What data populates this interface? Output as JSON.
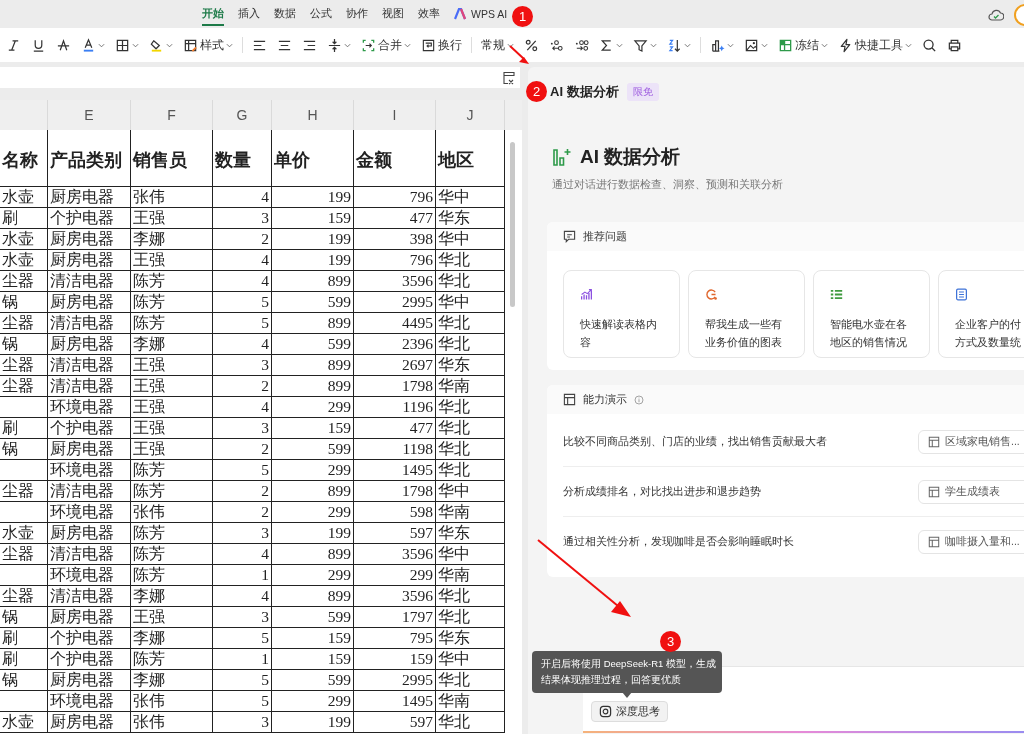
{
  "ribbon_tabs": [
    {
      "label": "开始",
      "selected": true,
      "kind": "tab"
    },
    {
      "label": "插入",
      "selected": false,
      "kind": "tab"
    },
    {
      "label": "数据",
      "selected": false,
      "kind": "tab"
    },
    {
      "label": "公式",
      "selected": false,
      "kind": "tab"
    },
    {
      "label": "协作",
      "selected": false,
      "kind": "tab"
    },
    {
      "label": "视图",
      "selected": false,
      "kind": "tab"
    },
    {
      "label": "效率",
      "selected": false,
      "kind": "tab"
    },
    {
      "label": "WPS AI",
      "selected": false,
      "kind": "ai"
    }
  ],
  "toolbar": [
    {
      "kind": "italic",
      "caret": false
    },
    {
      "kind": "underline",
      "caret": false
    },
    {
      "kind": "strike",
      "caret": false
    },
    {
      "kind": "fontcolor",
      "caret": true
    },
    {
      "kind": "border",
      "caret": true
    },
    {
      "kind": "fill",
      "caret": true
    },
    {
      "kind": "style",
      "label": "样式",
      "caret": true
    },
    {
      "kind": "separator"
    },
    {
      "kind": "alignleft",
      "caret": false
    },
    {
      "kind": "aligncenter",
      "caret": false
    },
    {
      "kind": "alignright",
      "caret": false
    },
    {
      "kind": "valign",
      "caret": true
    },
    {
      "kind": "merge",
      "label": "合并",
      "caret": true
    },
    {
      "kind": "wrap",
      "label": "换行",
      "caret": false
    },
    {
      "kind": "separator"
    },
    {
      "kind": "format",
      "label": "常规",
      "caret": true
    },
    {
      "kind": "percent",
      "caret": false
    },
    {
      "kind": "incdecimal",
      "caret": false
    },
    {
      "kind": "decdecimal",
      "caret": false
    },
    {
      "kind": "sum",
      "caret": true
    },
    {
      "kind": "filter",
      "caret": true
    },
    {
      "kind": "sort",
      "caret": true
    },
    {
      "kind": "separator"
    },
    {
      "kind": "chart",
      "caret": true
    },
    {
      "kind": "image",
      "caret": true
    },
    {
      "kind": "freeze",
      "label": "冻结",
      "caret": true
    },
    {
      "kind": "quick",
      "label": "快捷工具",
      "caret": true
    },
    {
      "kind": "search",
      "caret": false
    },
    {
      "kind": "print",
      "caret": false
    }
  ],
  "sheet": {
    "columns": [
      "E",
      "F",
      "G",
      "H",
      "I",
      "J"
    ],
    "header_row": {
      "cut": "名称",
      "cells": [
        "产品类别",
        "销售员",
        "数量",
        "单价",
        "金额",
        "地区"
      ]
    },
    "rows": [
      {
        "cut": "水壶",
        "cells": [
          "厨房电器",
          "张伟",
          "4",
          "199",
          "796",
          "华中"
        ]
      },
      {
        "cut": "刷",
        "cells": [
          "个护电器",
          "王强",
          "3",
          "159",
          "477",
          "华东"
        ]
      },
      {
        "cut": "水壶",
        "cells": [
          "厨房电器",
          "李娜",
          "2",
          "199",
          "398",
          "华中"
        ]
      },
      {
        "cut": "水壶",
        "cells": [
          "厨房电器",
          "王强",
          "4",
          "199",
          "796",
          "华北"
        ]
      },
      {
        "cut": "尘器",
        "cells": [
          "清洁电器",
          "陈芳",
          "4",
          "899",
          "3596",
          "华北"
        ]
      },
      {
        "cut": "锅",
        "cells": [
          "厨房电器",
          "陈芳",
          "5",
          "599",
          "2995",
          "华中"
        ]
      },
      {
        "cut": "尘器",
        "cells": [
          "清洁电器",
          "陈芳",
          "5",
          "899",
          "4495",
          "华北"
        ]
      },
      {
        "cut": "锅",
        "cells": [
          "厨房电器",
          "李娜",
          "4",
          "599",
          "2396",
          "华北"
        ]
      },
      {
        "cut": "尘器",
        "cells": [
          "清洁电器",
          "王强",
          "3",
          "899",
          "2697",
          "华东"
        ]
      },
      {
        "cut": "尘器",
        "cells": [
          "清洁电器",
          "王强",
          "2",
          "899",
          "1798",
          "华南"
        ]
      },
      {
        "cells": [
          "环境电器",
          "王强",
          "4",
          "299",
          "1196",
          "华北"
        ]
      },
      {
        "cut": "刷",
        "cells": [
          "个护电器",
          "王强",
          "3",
          "159",
          "477",
          "华北"
        ]
      },
      {
        "cut": "锅",
        "cells": [
          "厨房电器",
          "王强",
          "2",
          "599",
          "1198",
          "华北"
        ]
      },
      {
        "cells": [
          "环境电器",
          "陈芳",
          "5",
          "299",
          "1495",
          "华北"
        ]
      },
      {
        "cut": "尘器",
        "cells": [
          "清洁电器",
          "陈芳",
          "2",
          "899",
          "1798",
          "华中"
        ]
      },
      {
        "cells": [
          "环境电器",
          "张伟",
          "2",
          "299",
          "598",
          "华南"
        ]
      },
      {
        "cut": "水壶",
        "cells": [
          "厨房电器",
          "陈芳",
          "3",
          "199",
          "597",
          "华东"
        ]
      },
      {
        "cut": "尘器",
        "cells": [
          "清洁电器",
          "陈芳",
          "4",
          "899",
          "3596",
          "华中"
        ]
      },
      {
        "cells": [
          "环境电器",
          "陈芳",
          "1",
          "299",
          "299",
          "华南"
        ]
      },
      {
        "cut": "尘器",
        "cells": [
          "清洁电器",
          "李娜",
          "4",
          "899",
          "3596",
          "华北"
        ]
      },
      {
        "cut": "锅",
        "cells": [
          "厨房电器",
          "王强",
          "3",
          "599",
          "1797",
          "华北"
        ]
      },
      {
        "cut": "刷",
        "cells": [
          "个护电器",
          "李娜",
          "5",
          "159",
          "795",
          "华东"
        ]
      },
      {
        "cut": "刷",
        "cells": [
          "个护电器",
          "陈芳",
          "1",
          "159",
          "159",
          "华中"
        ]
      },
      {
        "cut": "锅",
        "cells": [
          "厨房电器",
          "李娜",
          "5",
          "599",
          "2995",
          "华北"
        ]
      },
      {
        "cells": [
          "环境电器",
          "张伟",
          "5",
          "299",
          "1495",
          "华南"
        ]
      },
      {
        "cut": "水壶",
        "cells": [
          "厨房电器",
          "张伟",
          "3",
          "199",
          "597",
          "华北"
        ]
      }
    ]
  },
  "panel": {
    "title": "AI 数据分析",
    "badge": "限免",
    "heading": "AI 数据分析",
    "subtitle": "通过对话进行数据检查、洞察、预测和关联分析",
    "suggestions": {
      "title": "推荐问题",
      "items": [
        {
          "lines": [
            "快速解读表格内",
            "容"
          ],
          "color": "#8b4fe0"
        },
        {
          "lines": [
            "帮我生成一些有",
            "业务价值的图表"
          ],
          "color": "#e0662c"
        },
        {
          "lines": [
            "智能电水壶在各",
            "地区的销售情况"
          ],
          "color": "#3f9a3f"
        },
        {
          "lines": [
            "企业客户的付",
            "方式及数量统"
          ],
          "color": "#3d72d8"
        }
      ]
    },
    "demos": {
      "title": "能力演示",
      "items": [
        {
          "text": "比较不同商品类别、门店的业绩，找出销售贡献最大者",
          "chip": "区域家电销售..."
        },
        {
          "text": "分析成绩排名，对比找出进步和退步趋势",
          "chip": "学生成绩表"
        },
        {
          "text": "通过相关性分析，发现咖啡是否会影响睡眠时长",
          "chip": "咖啡摄入量和..."
        }
      ]
    },
    "tooltip": [
      "开启后将使用 DeepSeek-R1 模型，生成",
      "结果体现推理过程，回答更优质"
    ],
    "deep_think": "深度思考"
  },
  "annotations": [
    {
      "label": "1"
    },
    {
      "label": "2"
    },
    {
      "label": "3"
    }
  ]
}
